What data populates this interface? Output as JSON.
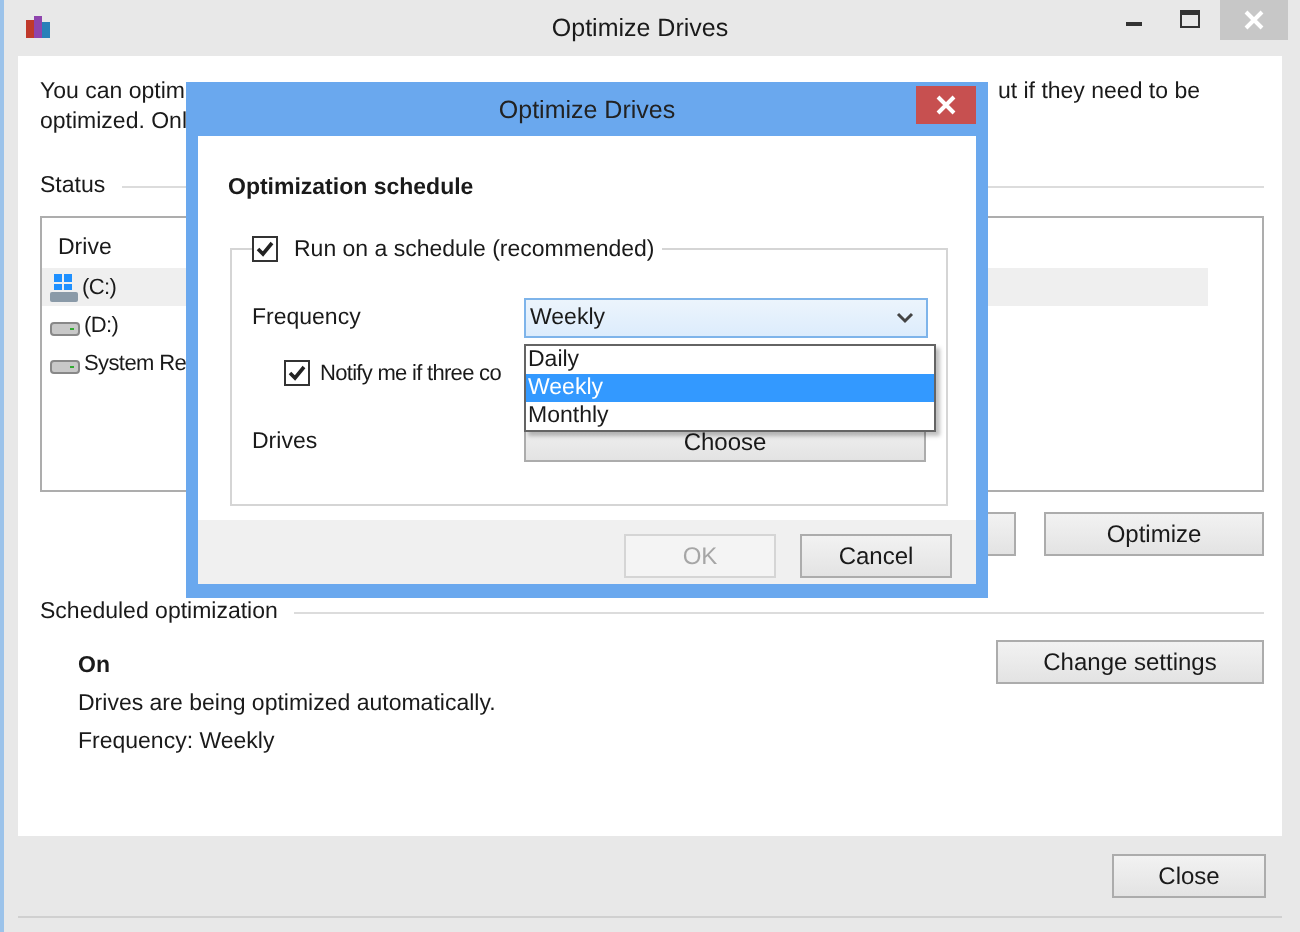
{
  "main_window": {
    "title": "Optimize Drives",
    "intro": [
      {
        "left": "You can optim",
        "right": "ut if they need to be"
      },
      {
        "left": "optimized. Onl"
      }
    ],
    "status_label": "Status",
    "drive_list": {
      "column": "Drive",
      "rows": [
        {
          "name": "(C:)",
          "kind": "system",
          "selected": true
        },
        {
          "name": "(D:)",
          "kind": "disk",
          "selected": false
        },
        {
          "name": "System Re",
          "kind": "disk",
          "selected": false
        }
      ]
    },
    "optimize_button": "Optimize",
    "scheduled": {
      "label": "Scheduled optimization",
      "state": "On",
      "description": "Drives are being optimized automatically.",
      "frequency": "Frequency: Weekly",
      "button": "Change settings"
    },
    "close_button": "Close"
  },
  "dialog": {
    "title": "Optimize Drives",
    "heading": "Optimization schedule",
    "run_on_schedule": {
      "label": "Run on a schedule (recommended)",
      "checked": true
    },
    "frequency_label": "Frequency",
    "frequency": {
      "value": "Weekly",
      "options": [
        {
          "label": "Daily",
          "selected": false
        },
        {
          "label": "Weekly",
          "selected": true
        },
        {
          "label": "Monthly",
          "selected": false
        }
      ]
    },
    "notify": {
      "label": "Notify me if three co",
      "checked": true
    },
    "drives_label": "Drives",
    "choose_button": "Choose",
    "ok_button": {
      "label": "OK",
      "disabled": true
    },
    "cancel_button": "Cancel"
  }
}
